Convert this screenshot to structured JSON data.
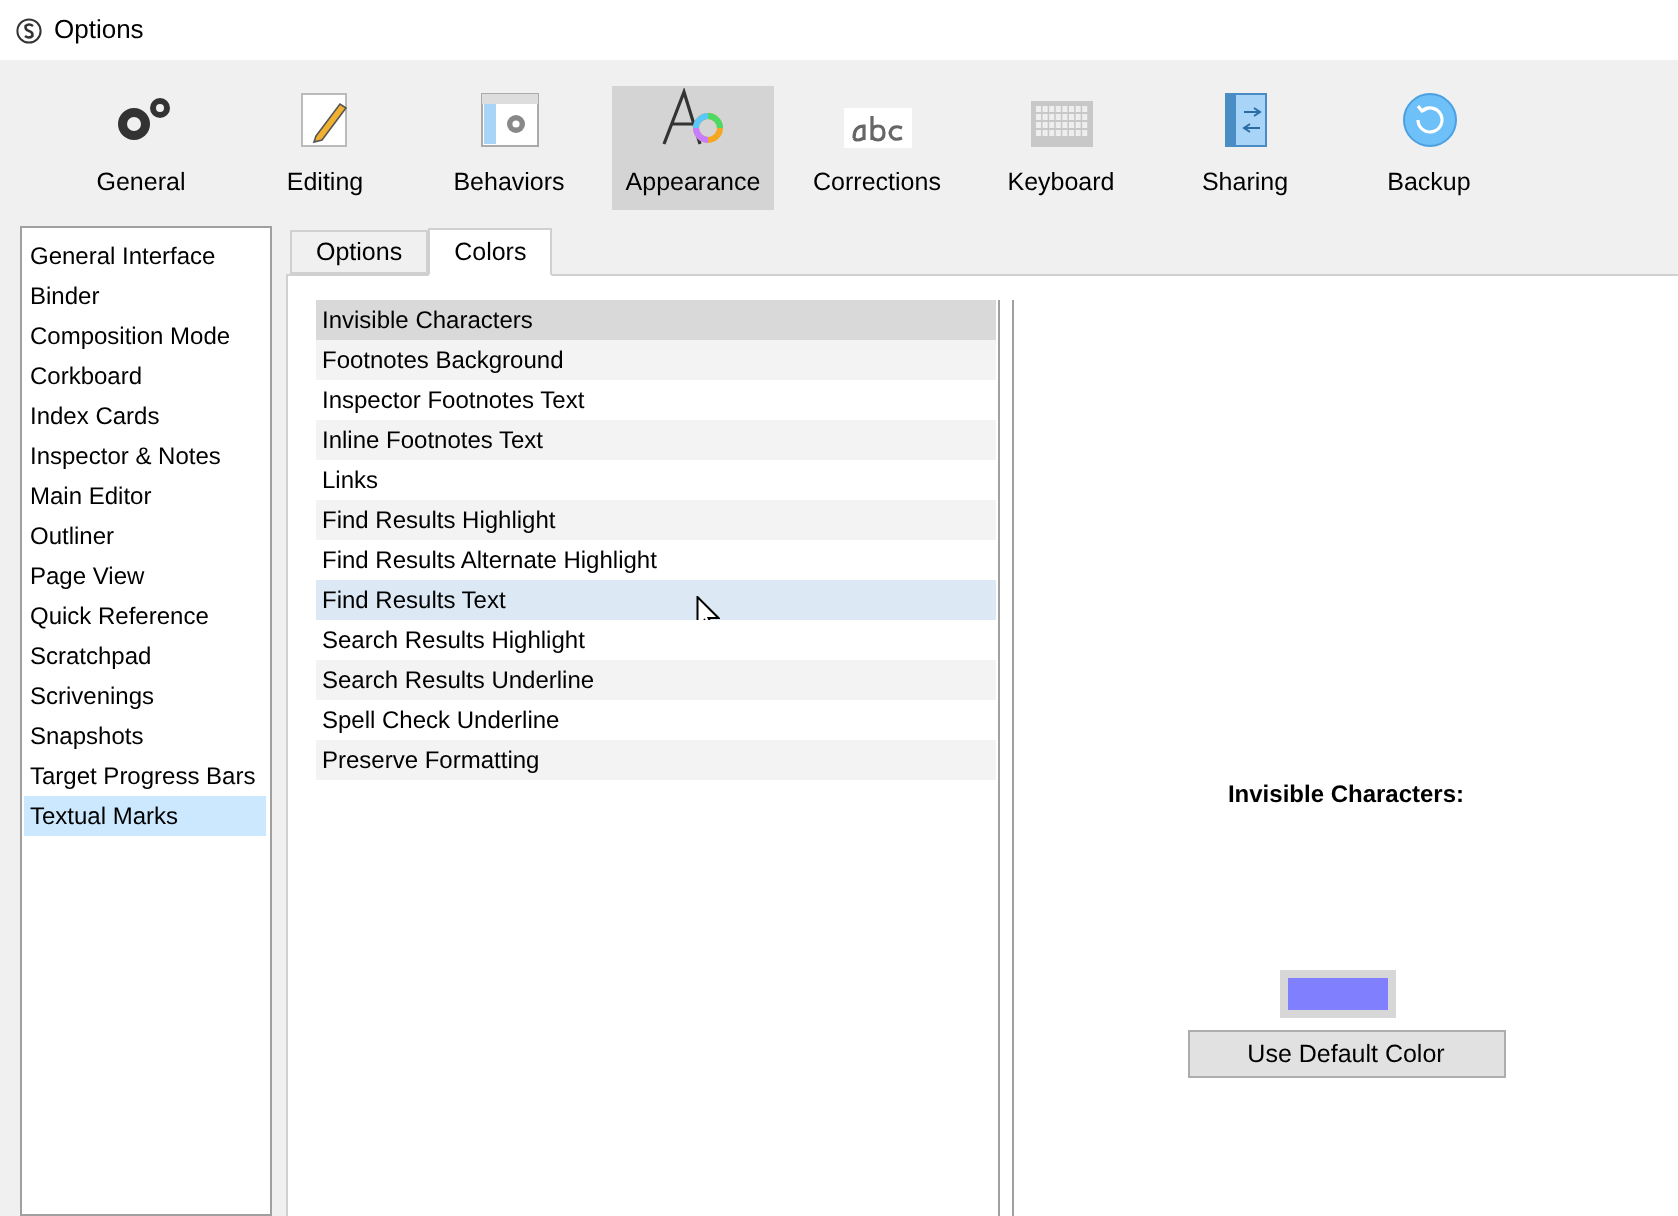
{
  "window": {
    "title": "Options"
  },
  "toolbar": [
    {
      "label": "General",
      "selected": false
    },
    {
      "label": "Editing",
      "selected": false
    },
    {
      "label": "Behaviors",
      "selected": false
    },
    {
      "label": "Appearance",
      "selected": true
    },
    {
      "label": "Corrections",
      "selected": false
    },
    {
      "label": "Keyboard",
      "selected": false
    },
    {
      "label": "Sharing",
      "selected": false
    },
    {
      "label": "Backup",
      "selected": false
    }
  ],
  "sidebar": {
    "items": [
      {
        "label": "General Interface",
        "selected": false
      },
      {
        "label": "Binder",
        "selected": false
      },
      {
        "label": "Composition Mode",
        "selected": false
      },
      {
        "label": "Corkboard",
        "selected": false
      },
      {
        "label": "Index Cards",
        "selected": false
      },
      {
        "label": "Inspector & Notes",
        "selected": false
      },
      {
        "label": "Main Editor",
        "selected": false
      },
      {
        "label": "Outliner",
        "selected": false
      },
      {
        "label": "Page View",
        "selected": false
      },
      {
        "label": "Quick Reference",
        "selected": false
      },
      {
        "label": "Scratchpad",
        "selected": false
      },
      {
        "label": "Scrivenings",
        "selected": false
      },
      {
        "label": "Snapshots",
        "selected": false
      },
      {
        "label": "Target Progress Bars",
        "selected": false
      },
      {
        "label": "Textual Marks",
        "selected": true
      }
    ]
  },
  "tabs": [
    {
      "label": "Options",
      "selected": false
    },
    {
      "label": "Colors",
      "selected": true
    }
  ],
  "color_list": [
    {
      "label": "Invisible Characters",
      "selected": true,
      "hovered": false
    },
    {
      "label": "Footnotes Background",
      "selected": false,
      "hovered": false
    },
    {
      "label": "Inspector Footnotes Text",
      "selected": false,
      "hovered": false
    },
    {
      "label": "Inline Footnotes Text",
      "selected": false,
      "hovered": false
    },
    {
      "label": "Links",
      "selected": false,
      "hovered": false
    },
    {
      "label": "Find Results Highlight",
      "selected": false,
      "hovered": false
    },
    {
      "label": "Find Results Alternate Highlight",
      "selected": false,
      "hovered": false
    },
    {
      "label": "Find Results Text",
      "selected": false,
      "hovered": true
    },
    {
      "label": "Search Results Highlight",
      "selected": false,
      "hovered": false
    },
    {
      "label": "Search Results Underline",
      "selected": false,
      "hovered": false
    },
    {
      "label": "Spell Check Underline",
      "selected": false,
      "hovered": false
    },
    {
      "label": "Preserve Formatting",
      "selected": false,
      "hovered": false
    }
  ],
  "detail": {
    "heading": "Invisible Characters:",
    "swatch": {
      "color": "#8080ff"
    },
    "button": "Use Default Color"
  }
}
